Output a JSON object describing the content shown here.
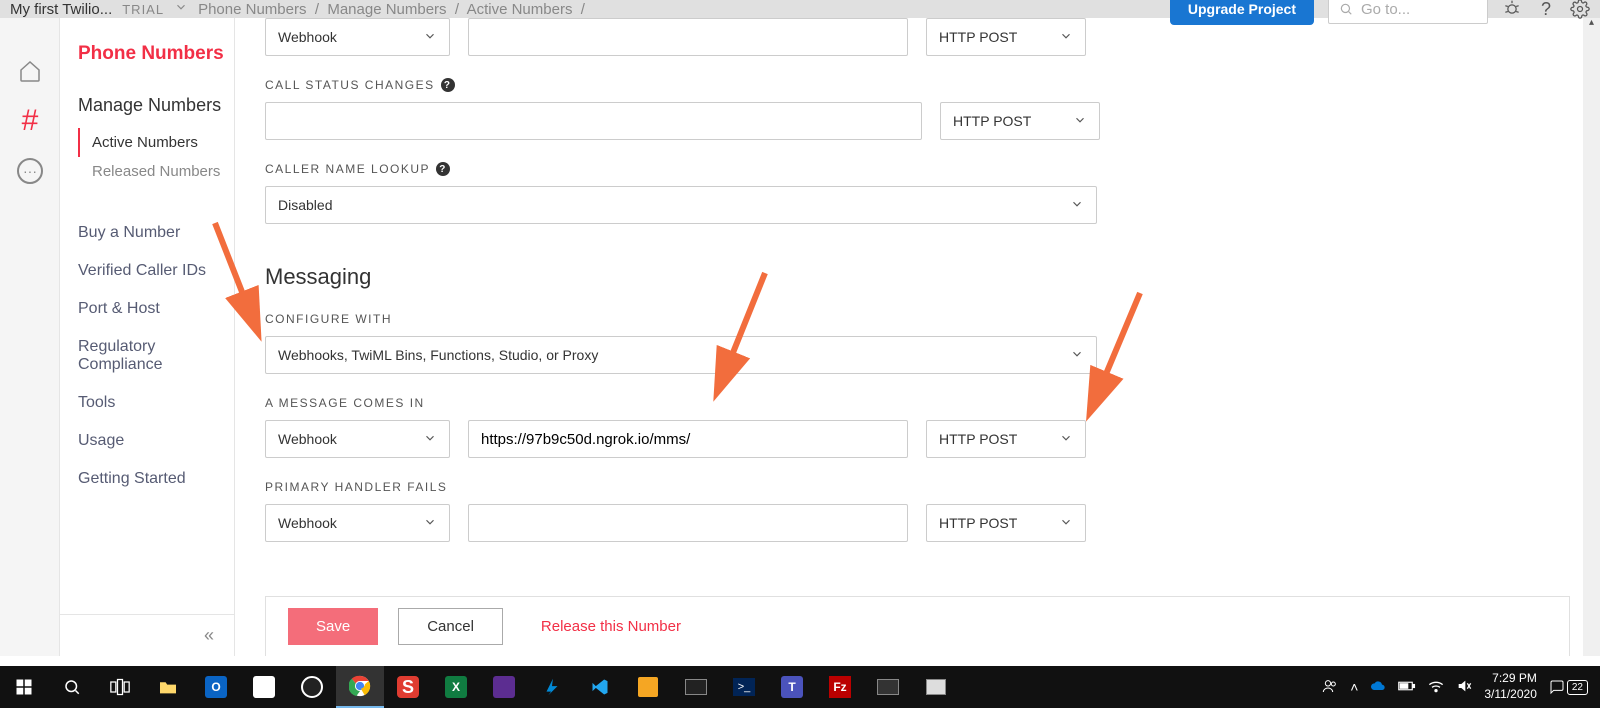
{
  "topbar": {
    "project_name": "My first Twilio...",
    "trial_label": "TRIAL",
    "crumb1": "Phone Numbers",
    "crumb2": "Manage Numbers",
    "crumb3": "Active Numbers",
    "upgrade_label": "Upgrade Project",
    "goto_placeholder": "Go to..."
  },
  "sidebar": {
    "title": "Phone Numbers",
    "manage_label": "Manage Numbers",
    "sub_active": "Active Numbers",
    "sub_released": "Released Numbers",
    "nav_buy": "Buy a Number",
    "nav_verified": "Verified Caller IDs",
    "nav_port": "Port & Host",
    "nav_regulatory": "Regulatory Compliance",
    "nav_tools": "Tools",
    "nav_usage": "Usage",
    "nav_getting_started": "Getting Started"
  },
  "voice": {
    "handler_value": "Webhook",
    "method_value": "HTTP POST",
    "call_status_label": "CALL STATUS CHANGES",
    "call_status_url": "",
    "call_status_method": "HTTP POST",
    "caller_lookup_label": "CALLER NAME LOOKUP",
    "caller_lookup_value": "Disabled"
  },
  "messaging": {
    "section_title": "Messaging",
    "configure_with_label": "CONFIGURE WITH",
    "configure_with_value": "Webhooks, TwiML Bins, Functions, Studio, or Proxy",
    "message_comes_in_label": "A MESSAGE COMES IN",
    "message_handler": "Webhook",
    "message_url": "https://97b9c50d.ngrok.io/mms/",
    "message_method": "HTTP POST",
    "primary_fails_label": "PRIMARY HANDLER FAILS",
    "primary_fails_handler": "Webhook",
    "primary_fails_url": "",
    "primary_fails_method": "HTTP POST"
  },
  "actions": {
    "save_label": "Save",
    "cancel_label": "Cancel",
    "release_label": "Release this Number"
  },
  "clock": {
    "time": "7:29 PM",
    "date": "3/11/2020",
    "notif_count": "22"
  }
}
